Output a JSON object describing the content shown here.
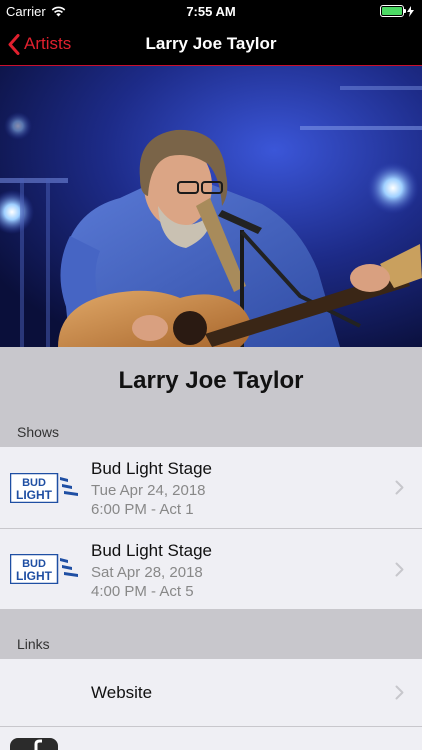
{
  "status_bar": {
    "carrier": "Carrier",
    "time": "7:55 AM"
  },
  "nav": {
    "back_label": "Artists",
    "title": "Larry Joe Taylor"
  },
  "artist": {
    "name": "Larry Joe Taylor"
  },
  "shows": {
    "header": "Shows",
    "items": [
      {
        "logo_text_1": "BUD",
        "logo_text_2": "LIGHT",
        "stage": "Bud Light Stage",
        "date": "Tue Apr 24, 2018",
        "time": "6:00 PM - Act 1"
      },
      {
        "logo_text_1": "BUD",
        "logo_text_2": "LIGHT",
        "stage": "Bud Light Stage",
        "date": "Sat Apr 28, 2018",
        "time": "4:00 PM - Act 5"
      }
    ]
  },
  "links": {
    "header": "Links",
    "items": [
      {
        "label": "Website"
      }
    ]
  },
  "colors": {
    "accent": "#e0202e",
    "nav_bg": "#000000",
    "band": "#c8c7cc",
    "row_bg": "#efeff4",
    "bud_blue": "#1f4fa3"
  }
}
